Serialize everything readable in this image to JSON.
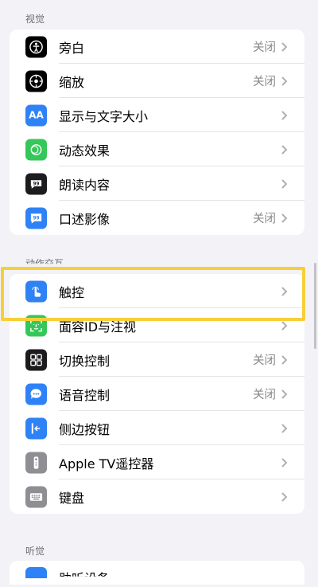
{
  "sections": {
    "vision": "视觉",
    "motor": "动作交互",
    "hearing": "听觉"
  },
  "vision_items": [
    {
      "label": "旁白",
      "value": "关闭",
      "icon": "voiceover-icon",
      "color": "#000000"
    },
    {
      "label": "缩放",
      "value": "关闭",
      "icon": "zoom-icon",
      "color": "#000000"
    },
    {
      "label": "显示与文字大小",
      "value": "",
      "icon": "text-size-icon",
      "color": "#2e82f6"
    },
    {
      "label": "动态效果",
      "value": "",
      "icon": "motion-icon",
      "color": "#34c759"
    },
    {
      "label": "朗读内容",
      "value": "",
      "icon": "spoken-content-icon",
      "color": "#1c1c1e"
    },
    {
      "label": "口述影像",
      "value": "关闭",
      "icon": "audio-description-icon",
      "color": "#2e82f6"
    }
  ],
  "motor_items": [
    {
      "label": "触控",
      "value": "",
      "icon": "touch-icon",
      "color": "#2e82f6"
    },
    {
      "label": "面容ID与注视",
      "value": "",
      "icon": "face-id-icon",
      "color": "#34c759"
    },
    {
      "label": "切换控制",
      "value": "关闭",
      "icon": "switch-control-icon",
      "color": "#1c1c1e"
    },
    {
      "label": "语音控制",
      "value": "关闭",
      "icon": "voice-control-icon",
      "color": "#2e82f6"
    },
    {
      "label": "侧边按钮",
      "value": "",
      "icon": "side-button-icon",
      "color": "#2e82f6"
    },
    {
      "label": "Apple TV遥控器",
      "value": "",
      "icon": "apple-tv-remote-icon",
      "color": "#8e8e93"
    },
    {
      "label": "键盘",
      "value": "",
      "icon": "keyboard-icon",
      "color": "#8e8e93"
    }
  ],
  "hearing_items": [
    {
      "label": "助听设备",
      "value": "",
      "icon": "hearing-devices-icon",
      "color": "#2e82f6"
    }
  ]
}
